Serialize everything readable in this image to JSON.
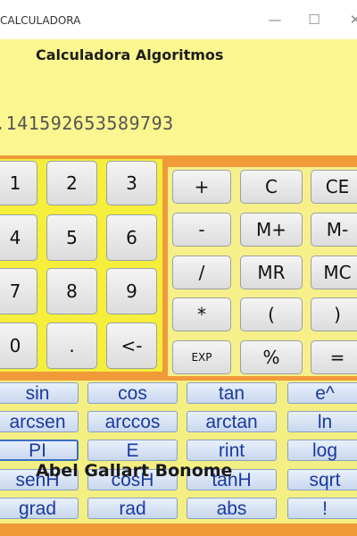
{
  "window": {
    "title": "CALCULADORA",
    "minimize_glyph": "—",
    "maximize_glyph": "☐",
    "close_glyph": "✕"
  },
  "app": {
    "title": "Calculadora Algoritmos",
    "display_value": ".141592653589793",
    "author": "Abel Gallart Bonome"
  },
  "keypad": {
    "row1": [
      "1",
      "2",
      "3"
    ],
    "row2": [
      "4",
      "5",
      "6"
    ],
    "row3": [
      "7",
      "8",
      "9"
    ],
    "row4": [
      "0",
      ".",
      "<-"
    ]
  },
  "operators": {
    "row1": [
      "+",
      "C",
      "CE"
    ],
    "row2": [
      "-",
      "M+",
      "M-"
    ],
    "row3": [
      "/",
      "MR",
      "MC"
    ],
    "row4": [
      "*",
      "(",
      ")"
    ],
    "row5": [
      "EXP",
      "%",
      "="
    ]
  },
  "functions": {
    "row1": [
      "sin",
      "cos",
      "tan",
      "e^"
    ],
    "row2": [
      "arcsen",
      "arccos",
      "arctan",
      "ln"
    ],
    "row3": [
      "PI",
      "E",
      "rint",
      "log"
    ],
    "row4": [
      "senH",
      "cosH",
      "tanH",
      "sqrt"
    ],
    "row5": [
      "grad",
      "rad",
      "abs",
      "!"
    ]
  },
  "colors": {
    "header_bg": "#fbf68f",
    "panel_orange": "#f09a3a",
    "numpad_yellow": "#f5ee3a",
    "function_text": "#1a3aa0"
  }
}
